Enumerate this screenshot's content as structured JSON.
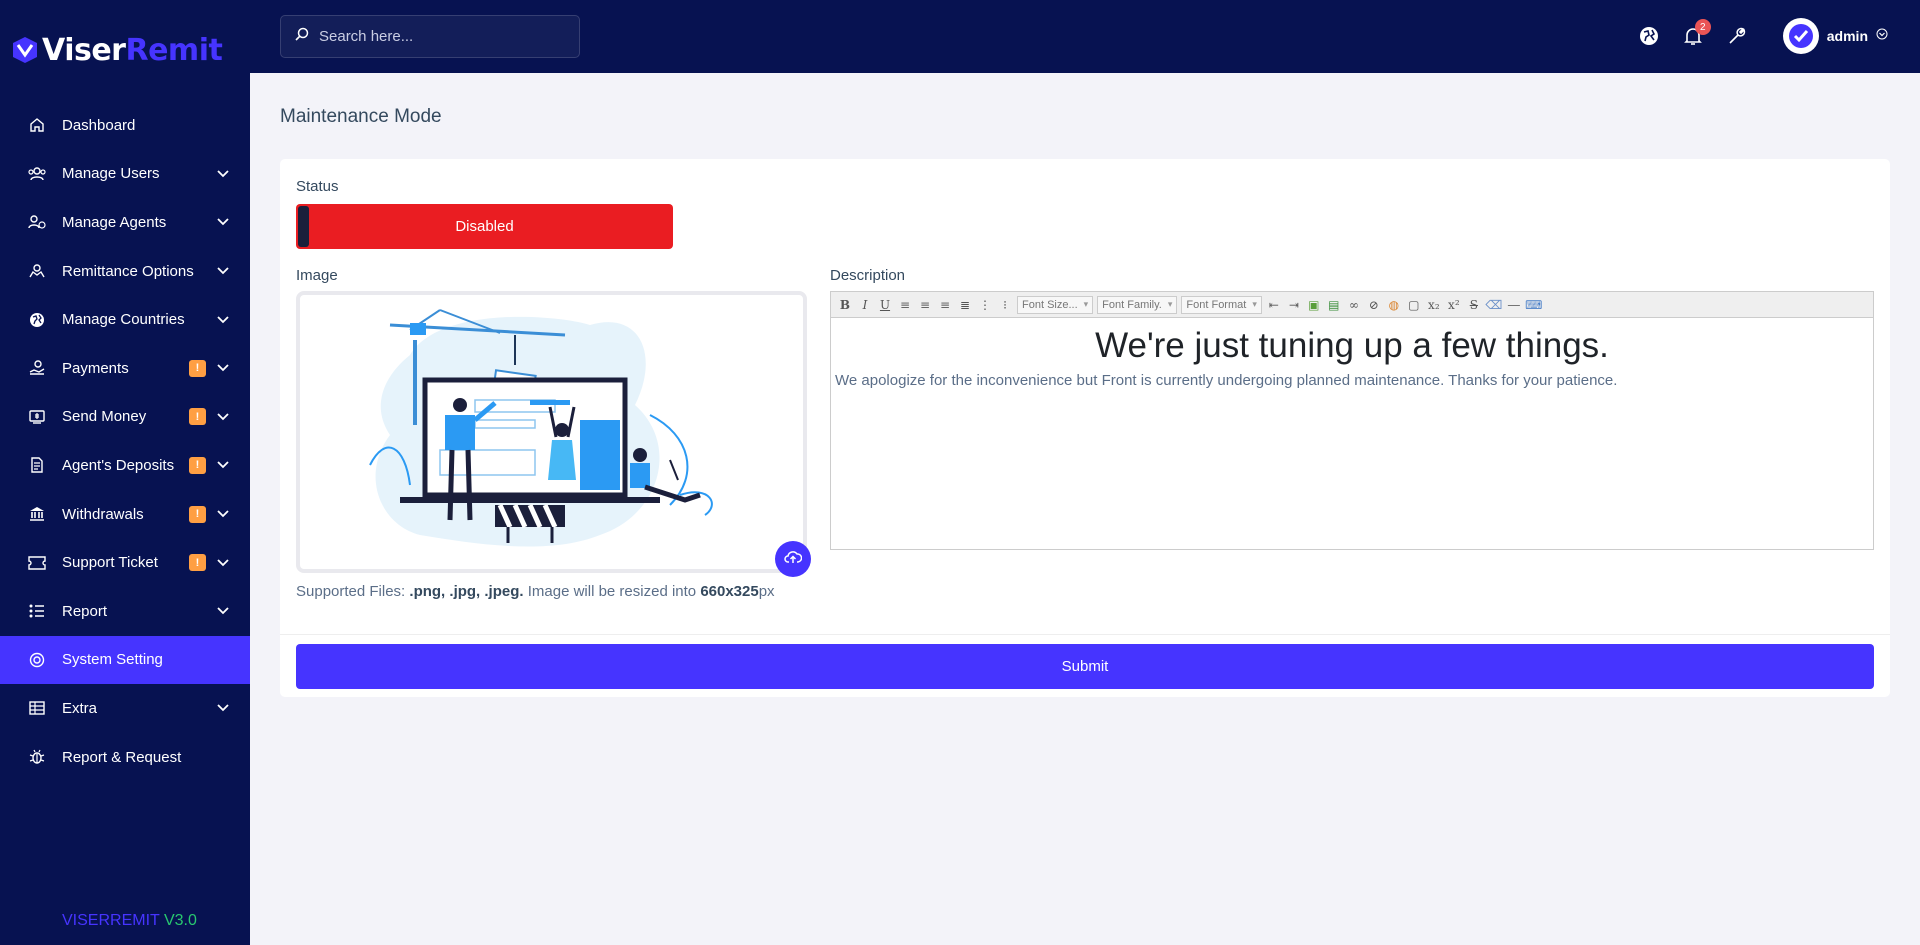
{
  "brand": {
    "logo_part1": "Viser",
    "logo_part2": "Remit",
    "version_name": "VISERREMIT",
    "version_number": "V3.0"
  },
  "search": {
    "placeholder": "Search here..."
  },
  "topbar": {
    "notification_count": "2",
    "username": "admin"
  },
  "sidebar": {
    "items": [
      {
        "label": "Dashboard",
        "icon": "home-icon",
        "has_badge": false,
        "has_chevron": false,
        "active": false
      },
      {
        "label": "Manage Users",
        "icon": "users-icon",
        "has_badge": false,
        "has_chevron": true,
        "active": false
      },
      {
        "label": "Manage Agents",
        "icon": "agents-icon",
        "has_badge": false,
        "has_chevron": true,
        "active": false
      },
      {
        "label": "Remittance Options",
        "icon": "remittance-icon",
        "has_badge": false,
        "has_chevron": true,
        "active": false
      },
      {
        "label": "Manage Countries",
        "icon": "globe-icon",
        "has_badge": false,
        "has_chevron": true,
        "active": false
      },
      {
        "label": "Payments",
        "icon": "payments-icon",
        "badge": "!",
        "has_chevron": true,
        "active": false
      },
      {
        "label": "Send Money",
        "icon": "send-money-icon",
        "badge": "!",
        "has_chevron": true,
        "active": false
      },
      {
        "label": "Agent's Deposits",
        "icon": "deposit-icon",
        "badge": "!",
        "has_chevron": true,
        "active": false
      },
      {
        "label": "Withdrawals",
        "icon": "bank-icon",
        "badge": "!",
        "has_chevron": true,
        "active": false
      },
      {
        "label": "Support Ticket",
        "icon": "ticket-icon",
        "badge": "!",
        "has_chevron": true,
        "active": false
      },
      {
        "label": "Report",
        "icon": "list-icon",
        "has_badge": false,
        "has_chevron": true,
        "active": false
      },
      {
        "label": "System Setting",
        "icon": "life-ring-icon",
        "has_badge": false,
        "has_chevron": false,
        "active": true
      },
      {
        "label": "Extra",
        "icon": "table-icon",
        "has_badge": false,
        "has_chevron": true,
        "active": false
      },
      {
        "label": "Report & Request",
        "icon": "bug-icon",
        "has_badge": false,
        "has_chevron": false,
        "active": false
      }
    ]
  },
  "page": {
    "title": "Maintenance Mode"
  },
  "form": {
    "status_label": "Status",
    "status_value": "Disabled",
    "image_label": "Image",
    "image_alt": "maintenance illustration",
    "help_prefix": "Supported Files: ",
    "help_types": ".png, .jpg, .jpeg.",
    "help_middle": " Image will be resized into ",
    "help_size": "660x325",
    "help_suffix": "px",
    "description_label": "Description",
    "editor_toolbar": {
      "font_size": "Font Size...",
      "font_family": "Font Family.",
      "font_format": "Font Format"
    },
    "description_heading": "We're just tuning up a few things.",
    "description_text": "We apologize for the inconvenience but Front is currently undergoing planned maintenance. Thanks for your patience.",
    "submit_label": "Submit"
  },
  "colors": {
    "sidebar_bg": "#071251",
    "accent": "#4634ff",
    "danger": "#ea1d22",
    "warning": "#ff9f43",
    "page_bg": "#f3f3f9"
  }
}
